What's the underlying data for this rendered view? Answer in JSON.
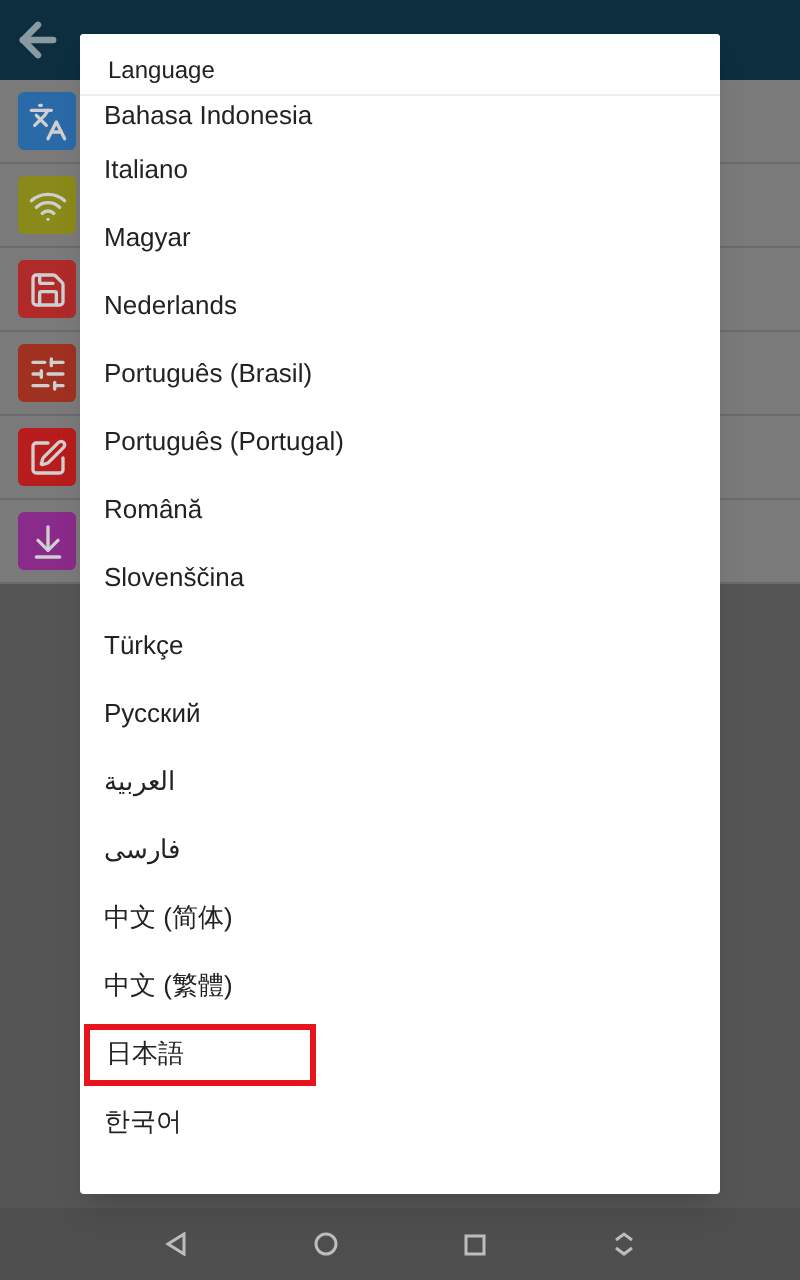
{
  "settings_rows": [
    {
      "kind": "language",
      "color": "#2a6aa8"
    },
    {
      "kind": "wifi",
      "color": "#8a8a1a"
    },
    {
      "kind": "storage",
      "color": "#b02a2a"
    },
    {
      "kind": "sliders",
      "color": "#a0301f"
    },
    {
      "kind": "edit",
      "color": "#b81c1c"
    },
    {
      "kind": "download",
      "color": "#8a2a8a"
    }
  ],
  "dialog": {
    "title": "Language",
    "items": [
      {
        "label": "Bahasa Indonesia",
        "highlighted": false
      },
      {
        "label": "Italiano",
        "highlighted": false
      },
      {
        "label": "Magyar",
        "highlighted": false
      },
      {
        "label": "Nederlands",
        "highlighted": false
      },
      {
        "label": "Português (Brasil)",
        "highlighted": false
      },
      {
        "label": "Português (Portugal)",
        "highlighted": false
      },
      {
        "label": "Română",
        "highlighted": false
      },
      {
        "label": "Slovenščina",
        "highlighted": false
      },
      {
        "label": "Türkçe",
        "highlighted": false
      },
      {
        "label": "Русский",
        "highlighted": false
      },
      {
        "label": "العربية",
        "highlighted": false
      },
      {
        "label": "فارسی",
        "highlighted": false
      },
      {
        "label": "中文 (简体)",
        "highlighted": false
      },
      {
        "label": "中文 (繁體)",
        "highlighted": false
      },
      {
        "label": "日本語",
        "highlighted": true
      },
      {
        "label": "한국어",
        "highlighted": false
      }
    ]
  },
  "nav_bar": [
    {
      "kind": "back"
    },
    {
      "kind": "home"
    },
    {
      "kind": "recents"
    },
    {
      "kind": "rotate"
    }
  ]
}
